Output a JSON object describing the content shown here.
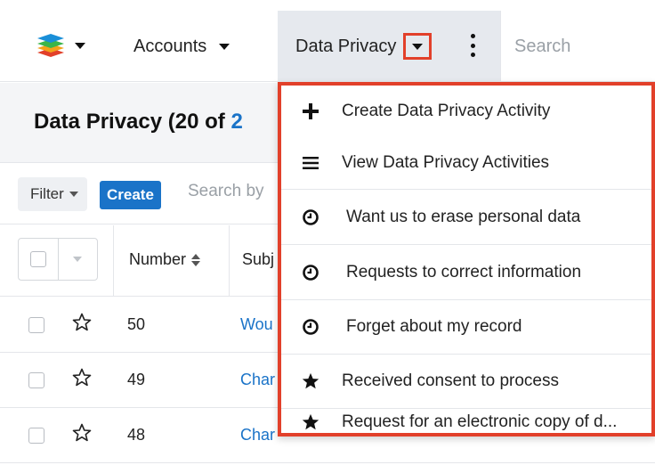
{
  "navbar": {
    "accounts_label": "Accounts",
    "data_privacy_label": "Data Privacy",
    "search_placeholder": "Search"
  },
  "page": {
    "title_prefix": "Data Privacy (20 of ",
    "title_link": "2"
  },
  "filter_bar": {
    "filter_label": "Filter",
    "create_label": "Create",
    "search_placeholder": "Search by"
  },
  "table": {
    "headers": {
      "number": "Number",
      "subject": "Subj"
    },
    "rows": [
      {
        "number": "50",
        "subject": "Wou"
      },
      {
        "number": "49",
        "subject": "Char"
      },
      {
        "number": "48",
        "subject": "Char"
      }
    ]
  },
  "dropdown": {
    "items": [
      {
        "label": "Create Data Privacy Activity",
        "icon": "plus-icon"
      },
      {
        "label": "View Data Privacy Activities",
        "icon": "list-icon"
      },
      {
        "label": "Want us to erase personal data",
        "icon": "clock-icon"
      },
      {
        "label": "Requests to correct information",
        "icon": "clock-icon"
      },
      {
        "label": "Forget about my record",
        "icon": "clock-icon"
      },
      {
        "label": "Received consent to process",
        "icon": "star-filled-icon"
      },
      {
        "label": "Request for an electronic copy of d...",
        "icon": "star-filled-icon"
      }
    ]
  },
  "colors": {
    "accent_blue": "#1a73c8",
    "highlight_red": "#e2402a",
    "nav_active_bg": "#e6e9ee"
  }
}
